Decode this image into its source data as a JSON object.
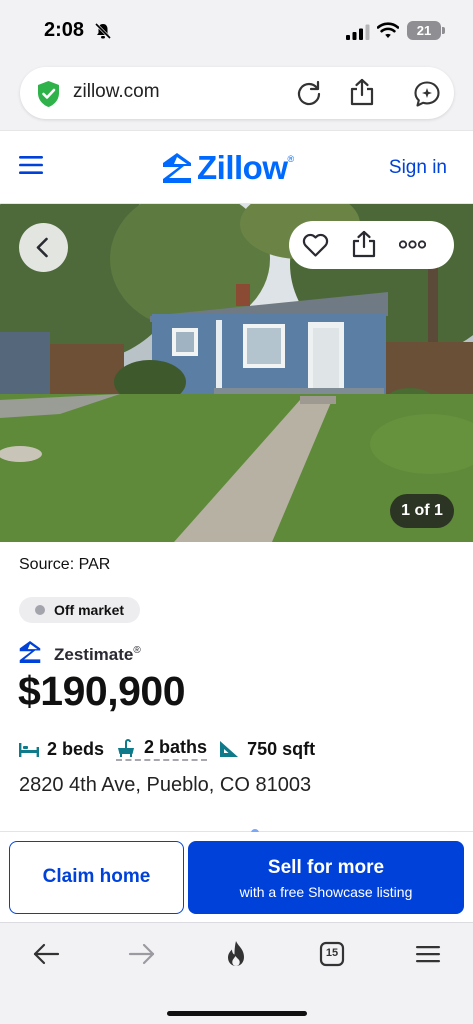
{
  "status_bar": {
    "time": "2:08",
    "battery": "21"
  },
  "browser": {
    "url": "zillow.com"
  },
  "header": {
    "logo_text": "Zillow",
    "logo_reg": "®",
    "sign_in": "Sign in",
    "brand_color": "#006aff"
  },
  "photo": {
    "counter": "1 of 1"
  },
  "listing": {
    "source": "Source: PAR",
    "status": "Off market",
    "zestimate_label": "Zestimate",
    "zestimate_reg": "®",
    "price": "$190,900",
    "beds": "2 beds",
    "baths": "2 baths",
    "sqft": "750 sqft",
    "address": "2820 4th Ave, Pueblo, CO 81003"
  },
  "cta": {
    "claim": "Claim home",
    "sell_title": "Sell for more",
    "sell_subtitle": "with a free Showcase listing",
    "accent": "#0041d9"
  },
  "toolbar": {
    "tab_count": "15"
  }
}
